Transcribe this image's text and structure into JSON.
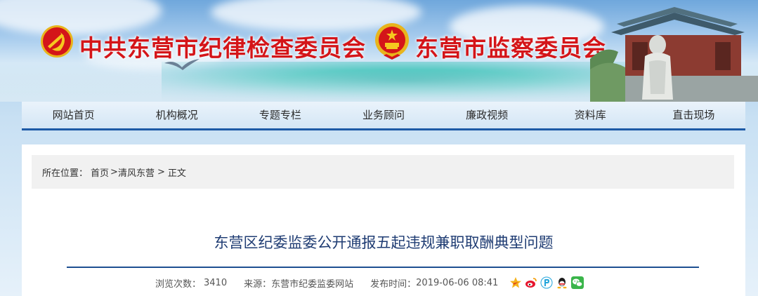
{
  "header": {
    "cpc_committee": "中共东营市纪律检查委员会",
    "supervision_committee": "东营市监察委员会"
  },
  "nav": {
    "items": [
      "网站首页",
      "机构概况",
      "专题专栏",
      "业务顾问",
      "廉政视频",
      "资料库",
      "直击现场"
    ]
  },
  "breadcrumb": {
    "label": "所在位置：",
    "home": "首页",
    "section": "清风东营",
    "current": "正文",
    "separator": ">"
  },
  "article": {
    "title": "东营区纪委监委公开通报五起违规兼职取酬典型问题",
    "views_label": "浏览次数：",
    "views": "3410",
    "source_label": "来源：",
    "source": "东营市纪委监委网站",
    "published_label": "发布时间：",
    "published": "2019-06-06 08:41"
  },
  "share": {
    "icons": [
      "qzone-icon",
      "weibo-icon",
      "pengyou-icon",
      "qq-icon",
      "wechat-icon"
    ]
  },
  "colors": {
    "title_red": "#d41519",
    "nav_border": "#1d5aa6",
    "article_title": "#1f3c73"
  }
}
